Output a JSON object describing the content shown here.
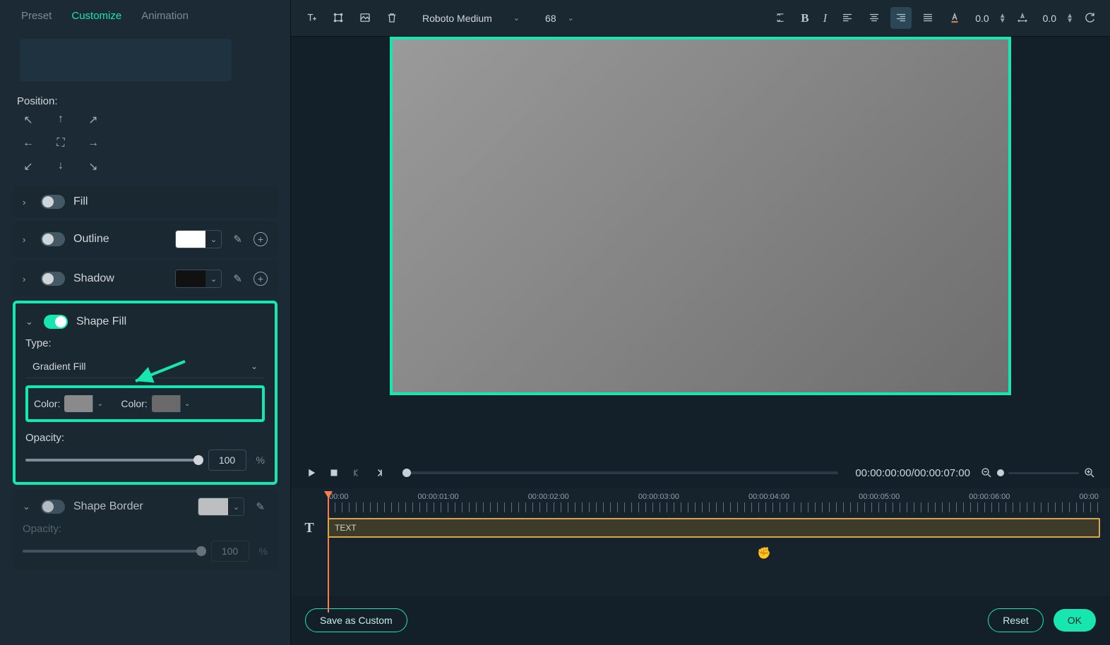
{
  "tabs": {
    "preset": "Preset",
    "customize": "Customize",
    "animation": "Animation"
  },
  "labels": {
    "position": "Position:",
    "fill": "Fill",
    "outline": "Outline",
    "shadow": "Shadow",
    "shapeFill": "Shape Fill",
    "type": "Type:",
    "gradientFill": "Gradient Fill",
    "color": "Color:",
    "opacity": "Opacity:",
    "shapeBorder": "Shape Border"
  },
  "values": {
    "opacity1": "100",
    "opacity2": "100",
    "pct": "%"
  },
  "toolbar": {
    "font": "Roboto Medium",
    "size": "68",
    "spacing1": "0.0",
    "spacing2": "0.0"
  },
  "playback": {
    "timecode": "00:00:00:00/00:00:07:00"
  },
  "ruler": [
    "00:00",
    "00:00:01:00",
    "00:00:02:00",
    "00:00:03:00",
    "00:00:04:00",
    "00:00:05:00",
    "00:00:06:00",
    "00:00"
  ],
  "clip": {
    "label": "TEXT"
  },
  "footer": {
    "save": "Save as Custom",
    "reset": "Reset",
    "ok": "OK"
  }
}
